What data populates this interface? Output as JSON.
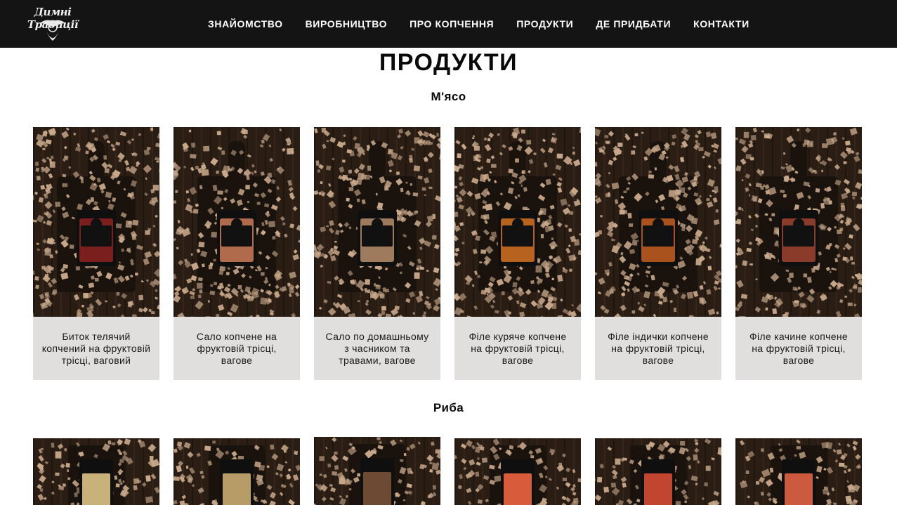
{
  "header": {
    "logo_text": "Димні Традиції",
    "nav": [
      {
        "label": "ЗНАЙОМСТВО"
      },
      {
        "label": "ВИРОБНИЦТВО"
      },
      {
        "label": "ПРО КОПЧЕННЯ"
      },
      {
        "label": "ПРОДУКТИ"
      },
      {
        "label": "ДЕ ПРИДБАТИ"
      },
      {
        "label": "КОНТАКТИ"
      }
    ]
  },
  "main": {
    "title": "ПРОДУКТИ",
    "sections": [
      {
        "title": "М'ясо",
        "products": [
          {
            "caption": "Биток телячий копчений на фруктовій трісці, ваговий",
            "package_color": "#7a1f1e"
          },
          {
            "caption": "Сало копчене на фруктовій трісці, вагове",
            "package_color": "#b06a4c"
          },
          {
            "caption": "Сало по домашньому з часником та травами, вагове",
            "package_color": "#9f7b5e"
          },
          {
            "caption": "Філе куряче копчене на фруктовій трісці, вагове",
            "package_color": "#b8621f"
          },
          {
            "caption": "Філе індички копчене на фруктовій трісці, вагове",
            "package_color": "#a9521d"
          },
          {
            "caption": "Філе качине копчене на фруктовій трісці, вагове",
            "package_color": "#8a3b2a"
          }
        ]
      },
      {
        "title": "Риба",
        "products": [
          {
            "caption": "",
            "package_color": "#c9b27a"
          },
          {
            "caption": "",
            "package_color": "#b79c68"
          },
          {
            "caption": "",
            "package_color": "#6d4a33"
          },
          {
            "caption": "",
            "package_color": "#d85b3c"
          },
          {
            "caption": "",
            "package_color": "#c2452f"
          },
          {
            "caption": "",
            "package_color": "#cc5a3e"
          }
        ]
      }
    ]
  },
  "colors": {
    "header_bg": "#141414",
    "caption_bg": "#e1dfde",
    "wood_dark": "#2a1d14",
    "chips": "#c9a98c"
  }
}
